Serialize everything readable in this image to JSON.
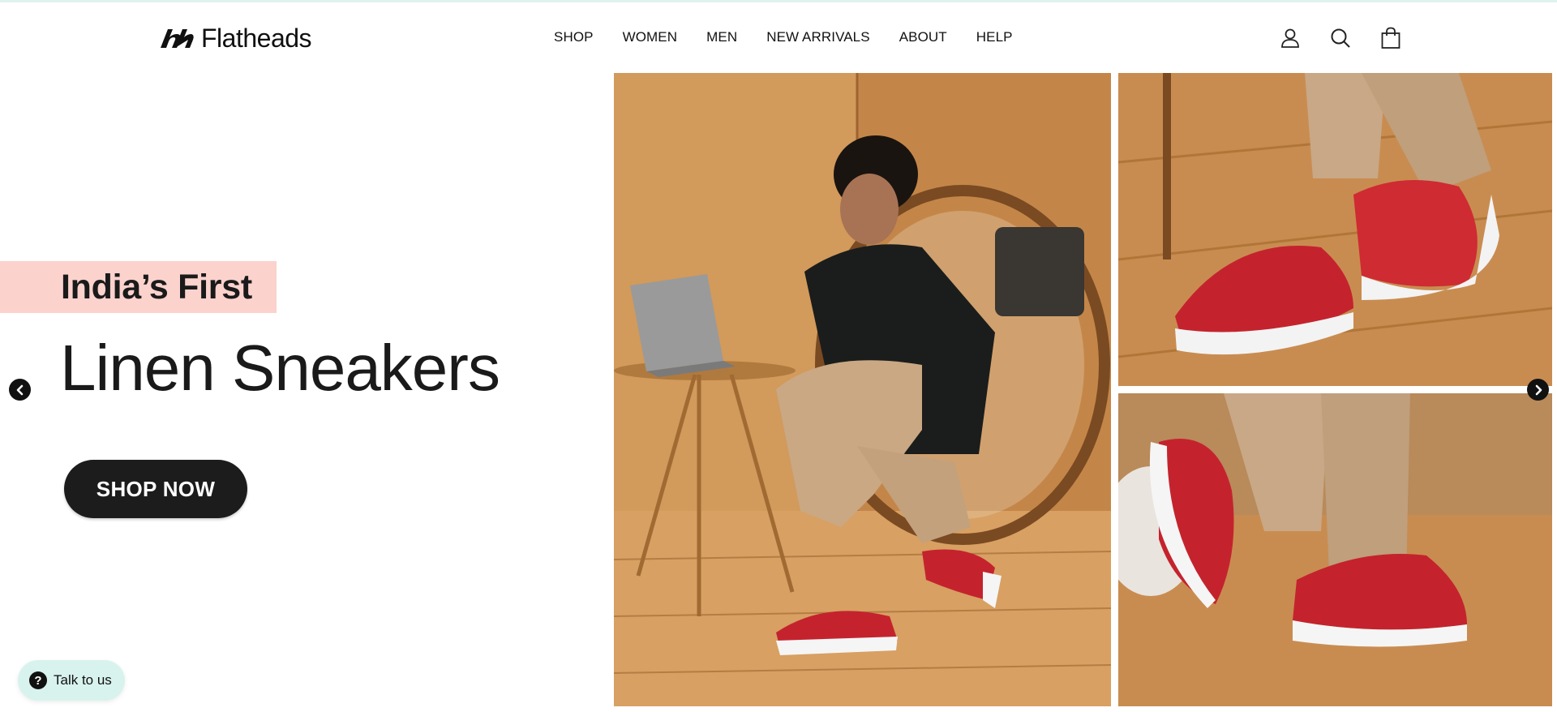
{
  "brand": {
    "name": "Flatheads",
    "logo_icon": "flatheads-logo-mark-icon"
  },
  "nav": {
    "items": [
      {
        "label": "SHOP"
      },
      {
        "label": "WOMEN"
      },
      {
        "label": "MEN"
      },
      {
        "label": "NEW ARRIVALS"
      },
      {
        "label": "ABOUT"
      },
      {
        "label": "HELP"
      }
    ]
  },
  "header_icons": [
    "account-icon",
    "search-icon",
    "cart-icon"
  ],
  "hero": {
    "badge": "India’s First",
    "headline": "Linen Sneakers",
    "cta_label": "SHOP NOW",
    "badge_color": "#fcd2cd",
    "cta_color": "#1c1c1c",
    "prev_icon": "chevron-left-icon",
    "next_icon": "chevron-right-icon",
    "images": [
      {
        "name": "man-on-chair-with-laptop-red-sneakers"
      },
      {
        "name": "feet-crossed-red-sneakers-wooden-floor"
      },
      {
        "name": "red-sneaker-closeup-side-view"
      }
    ]
  },
  "chat": {
    "label": "Talk to us",
    "icon": "question-icon",
    "color": "#d8f3ee"
  }
}
